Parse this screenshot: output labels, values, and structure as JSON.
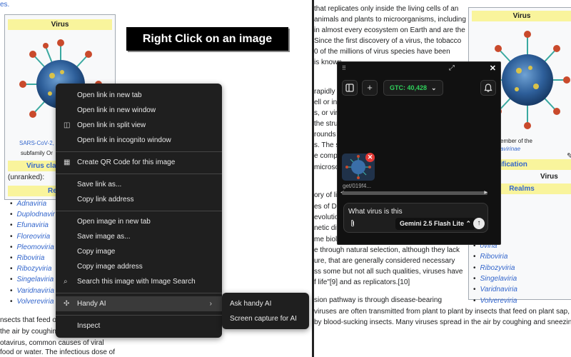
{
  "left_wiki": {
    "top_fragment": "es.",
    "infobox_title": "Virus",
    "caption_1": "SARS-CoV-2,",
    "caption_2": "subfamily Or",
    "classification": "Virus cla",
    "unranked": "(unranked):",
    "realms_header": "Re",
    "realms": [
      "Adnaviria",
      "Duplodnavir",
      "Efunaviria",
      "Floreoviria",
      "Pleomoviria",
      "Riboviria",
      "Ribozyviria",
      "Singelaviria",
      "Varidnaviria",
      "Volvereviria"
    ],
    "bottom_1": "nsects that feed on",
    "bottom_2": "the air by coughing",
    "bottom_3": "otavirus, common causes of viral",
    "bottom_4": "food or water. The infectious dose of"
  },
  "banner_text": "Right Click on an image",
  "right_wiki": {
    "lines": [
      "that replicates only inside the living cells of an",
      "animals and plants to microorganisms, including",
      "in almost every ecosystem on Earth and are the",
      "Since the first discovery of a virus, the tobacco",
      "0 of the millions of virus species have been",
      "is known",
      "rapidly p",
      "ell or in",
      "s, or vir",
      "the struc",
      "rounds",
      "s. The s",
      "e comple",
      "microsco",
      "ory of li",
      "es of DN",
      "evolution",
      "netic div",
      "me biolog",
      "e through natural selection, although they lack",
      "ure, that are generally considered necessary",
      "ss some but not all such qualities, viruses have",
      "f life\"[9] and as replicators.[10]",
      "sion pathway is through disease-bearing",
      "viruses are often transmitted from plant to plant by insects that feed on plant sap, such as",
      "by blood-sucking insects. Many viruses spread in the air by coughing and sneezing,"
    ],
    "infobox_title": "Virus",
    "caption_1": "CoV-2, a member of the",
    "caption_2": "Orthocoronavirinae",
    "classification": "us classification",
    "rank_label": "",
    "rank_value": "Virus",
    "realms_header": "Realms",
    "realms": [
      "viria",
      "aviria",
      "iria",
      "iria",
      "oviria",
      "Riboviria",
      "Ribozyviria",
      "Singelaviria",
      "Varidnaviria",
      "Volvereviria"
    ]
  },
  "ai_widget": {
    "gtc_label": "GTC: 40,428",
    "thumbnail_name": "get/019f4...",
    "prompt_text": "What virus is this",
    "model_label": "Gemini 2.5 Flash Lite",
    "colors": {
      "gtc": "#2fd15b",
      "bg": "#111111",
      "close_badge": "#e53935"
    }
  },
  "context_menu": {
    "items": [
      {
        "label": "Open link in new tab"
      },
      {
        "label": "Open link in new window"
      },
      {
        "label": "Open link in split view"
      },
      {
        "label": "Open link in incognito window"
      },
      {
        "label": "Create QR Code for this image"
      },
      {
        "label": "Save link as..."
      },
      {
        "label": "Copy link address"
      },
      {
        "label": "Open image in new tab"
      },
      {
        "label": "Save image as..."
      },
      {
        "label": "Copy image"
      },
      {
        "label": "Copy image address"
      },
      {
        "label": "Search this image with Image Search"
      },
      {
        "label": "Handy AI"
      },
      {
        "label": "Inspect"
      }
    ],
    "submenu": [
      {
        "label": "Ask handy AI"
      },
      {
        "label": "Screen capture for AI"
      }
    ]
  }
}
